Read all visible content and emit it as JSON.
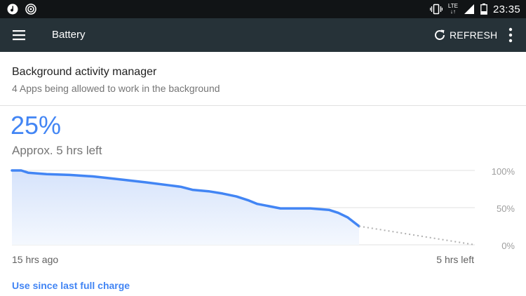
{
  "status_bar": {
    "network": "LTE",
    "time": "23:35",
    "icons": [
      "music-note-icon",
      "wireless-icon",
      "vibrate-icon",
      "signal-icon",
      "battery-icon"
    ]
  },
  "toolbar": {
    "title": "Battery",
    "refresh_label": "REFRESH"
  },
  "background_manager": {
    "title": "Background activity manager",
    "subtitle": "4 Apps being allowed to work in the background"
  },
  "battery": {
    "percent": "25%",
    "estimate": "Approx. 5 hrs left"
  },
  "chart_data": {
    "type": "line",
    "y_ticks": [
      "100%",
      "50%",
      "0%"
    ],
    "x_start_label": "15 hrs ago",
    "x_end_label": "5 hrs left",
    "ylim": [
      0,
      100
    ],
    "xlim": [
      -15,
      5
    ],
    "x_unit": "hours",
    "series": [
      {
        "style": "solid",
        "x": [
          -15,
          -14.6,
          -14.3,
          -13.5,
          -12.5,
          -11.5,
          -10.6,
          -9.2,
          -8.2,
          -7.7,
          -7.2,
          -6.5,
          -5.9,
          -5.3,
          -4.8,
          -4.4,
          -3.4,
          -2.6,
          -2.1,
          -1.3,
          -0.9,
          -0.5,
          0
        ],
        "values": [
          100,
          100,
          97,
          95,
          94,
          92,
          89,
          84,
          80,
          78,
          74,
          72,
          69,
          65,
          60,
          55,
          49,
          49,
          49,
          47,
          43,
          37,
          25
        ]
      },
      {
        "style": "dotted",
        "x": [
          0,
          5
        ],
        "values": [
          25,
          0
        ]
      }
    ],
    "grid": true
  },
  "footer": {
    "link_label": "Use since last full charge"
  }
}
